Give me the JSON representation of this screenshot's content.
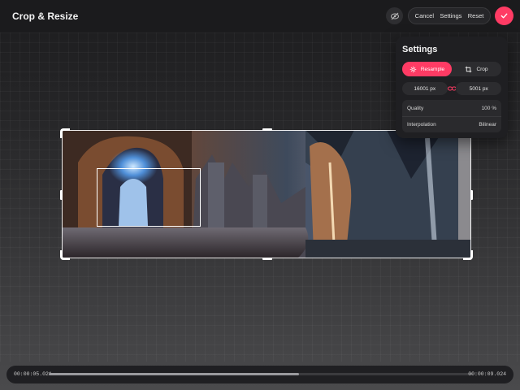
{
  "header": {
    "title": "Crop & Resize",
    "visibility_icon": "eye-off-icon",
    "actions": {
      "cancel": "Cancel",
      "settings": "Settings",
      "reset": "Reset"
    },
    "confirm_icon": "checkmark-icon"
  },
  "settings_panel": {
    "title": "Settings",
    "modes": [
      {
        "label": "Resample",
        "icon": "resample-icon",
        "active": true
      },
      {
        "label": "Crop",
        "icon": "crop-icon",
        "active": false
      }
    ],
    "width_value": "16001 px",
    "height_value": "5001 px",
    "link_icon": "chain-link-icon",
    "rows": [
      {
        "label": "Quality",
        "value": "100 %"
      },
      {
        "label": "Interpolation",
        "value": "Bilinear"
      }
    ]
  },
  "timeline": {
    "start_time": "00:00:05.021",
    "end_time": "00:00:09.024",
    "progress": 0.59
  },
  "colors": {
    "accent": "#ff3b64",
    "panel_bg": "#1f1f22",
    "header_bg": "#1b1b1d"
  }
}
